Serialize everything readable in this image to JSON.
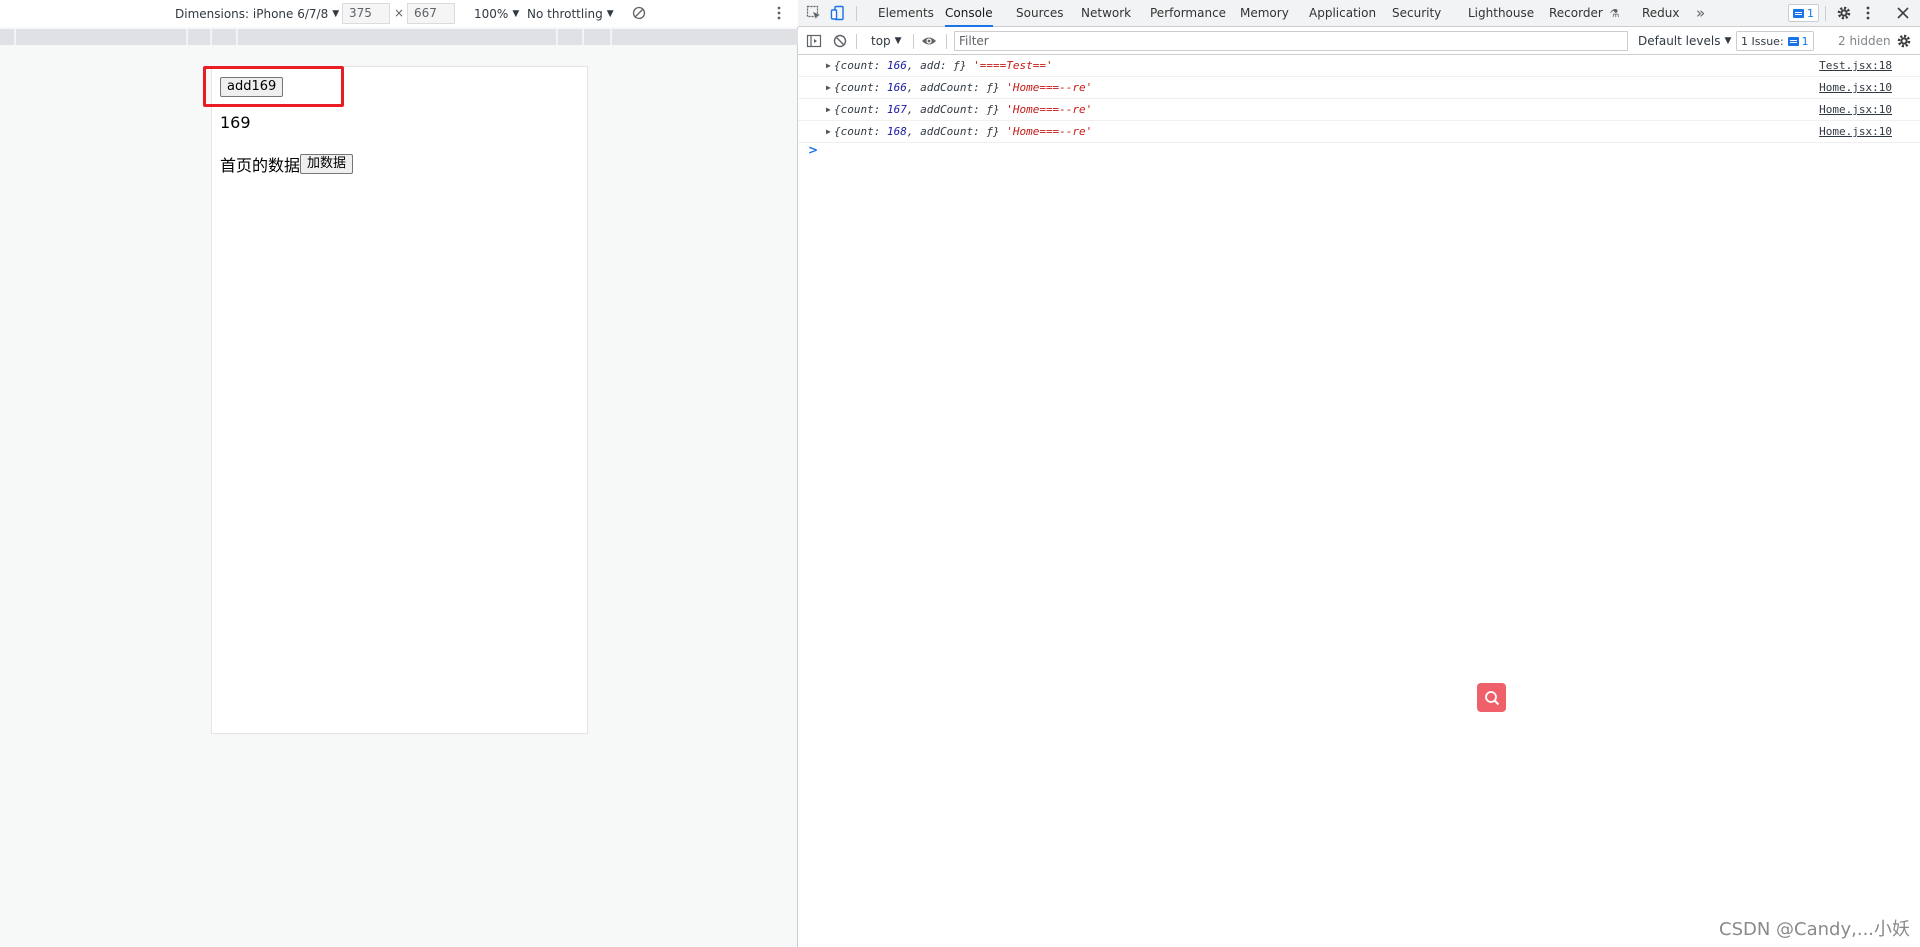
{
  "device_toolbar": {
    "dimensions_label": "Dimensions: iPhone 6/7/8",
    "width_value": "375",
    "times": "×",
    "height_value": "667",
    "zoom": "100%",
    "throttling": "No throttling"
  },
  "page": {
    "add_button_label": "add169",
    "count_text": "169",
    "home_data_label": "首页的数据",
    "add_data_button_label": "加数据"
  },
  "devtools": {
    "tabs": [
      "Elements",
      "Console",
      "Sources",
      "Network",
      "Performance",
      "Memory",
      "Application",
      "Security",
      "Lighthouse",
      "Recorder",
      "Redux"
    ],
    "active_tab": "Console",
    "more_tabs": "»",
    "issues_count": "1"
  },
  "console_toolbar": {
    "context": "top",
    "filter_placeholder": "Filter",
    "levels": "Default levels",
    "issues_label": "1 Issue:",
    "issues_count": "1",
    "hidden": "2 hidden"
  },
  "console_messages": [
    {
      "pre": "{count: ",
      "num": "166",
      "mid": ", add: ƒ} ",
      "str": "'====Test=='",
      "source": "Test.jsx:18"
    },
    {
      "pre": "{count: ",
      "num": "166",
      "mid": ", addCount: ƒ} ",
      "str": "'Home===--re'",
      "source": "Home.jsx:10"
    },
    {
      "pre": "{count: ",
      "num": "167",
      "mid": ", addCount: ƒ} ",
      "str": "'Home===--re'",
      "source": "Home.jsx:10"
    },
    {
      "pre": "{count: ",
      "num": "168",
      "mid": ", addCount: ƒ} ",
      "str": "'Home===--re'",
      "source": "Home.jsx:10"
    }
  ],
  "prompt_symbol": ">",
  "watermark": "CSDN @Candy,...小妖",
  "colors": {
    "highlight_box": "#ea1c24",
    "active_tab_underline": "#1a73e8",
    "search_fab": "#f0606a"
  }
}
